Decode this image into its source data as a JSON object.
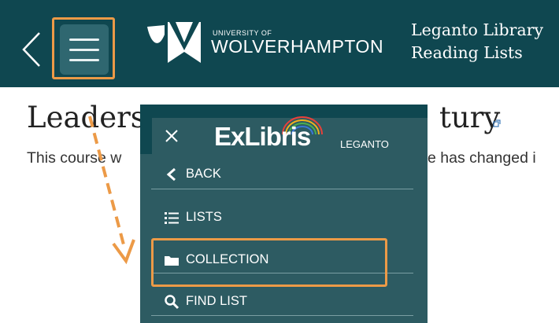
{
  "header": {
    "university_small": "UNIVERSITY OF",
    "university_name": "WOLVERHAMPTON",
    "title_line1": "Leganto Library",
    "title_line2": "Reading Lists",
    "icons": [
      "chevron-left-icon",
      "hamburger-menu-icon",
      "university-logo"
    ]
  },
  "page": {
    "title_start": "Leaders",
    "title_end": "tury",
    "description_start": "This course w",
    "description_end": "e has changed i"
  },
  "menu": {
    "brand": "ExLibris",
    "product": "LEGANTO",
    "items": [
      {
        "label": "BACK",
        "icon": "chevron-left-icon"
      },
      {
        "label": "LISTS",
        "icon": "list-icon"
      },
      {
        "label": "COLLECTION",
        "icon": "folder-icon"
      },
      {
        "label": "FIND LIST",
        "icon": "search-icon"
      }
    ]
  },
  "colors": {
    "header_bg": "#0f4750",
    "menu_bg": "#2d5b62",
    "highlight": "#ec9a47"
  }
}
